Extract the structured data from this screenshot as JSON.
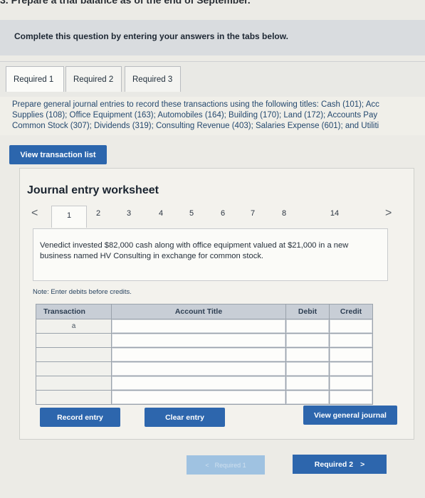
{
  "question_title": "3. Prepare a trial balance as of the end of September.",
  "instruction": "Complete this question by entering your answers in the tabs below.",
  "tabs": [
    {
      "label": "Required 1"
    },
    {
      "label": "Required 2"
    },
    {
      "label": "Required 3"
    }
  ],
  "description": {
    "line1": "Prepare general journal entries to record these transactions using the following titles: Cash (101); Acc",
    "line2": "Supplies (108); Office Equipment (163); Automobiles (164); Building (170); Land (172); Accounts Pay",
    "line3": "Common Stock (307); Dividends (319); Consulting Revenue (403); Salaries Expense (601); and Utiliti"
  },
  "view_transaction_list": "View transaction list",
  "worksheet": {
    "title": "Journal entry worksheet",
    "pager": {
      "prev": "<",
      "next": ">",
      "pages": [
        "1",
        "2",
        "3",
        "4",
        "5",
        "6",
        "7",
        "8",
        "14"
      ],
      "active_page": "1"
    },
    "transaction_text": "Venedict invested $82,000 cash along with office equipment valued at $21,000 in a new business named HV Consulting in exchange for common stock.",
    "note": "Note: Enter debits before credits.",
    "table": {
      "headers": {
        "transaction": "Transaction",
        "account_title": "Account Title",
        "debit": "Debit",
        "credit": "Credit"
      },
      "rows": [
        {
          "transaction": "a"
        },
        {
          "transaction": ""
        },
        {
          "transaction": ""
        },
        {
          "transaction": ""
        },
        {
          "transaction": ""
        },
        {
          "transaction": ""
        }
      ]
    },
    "buttons": {
      "record": "Record entry",
      "clear": "Clear entry",
      "view_journal": "View general journal"
    }
  },
  "nav": {
    "prev_label": "Required 1",
    "prev_arrow": "<",
    "next_label": "Required 2",
    "next_arrow": ">"
  }
}
